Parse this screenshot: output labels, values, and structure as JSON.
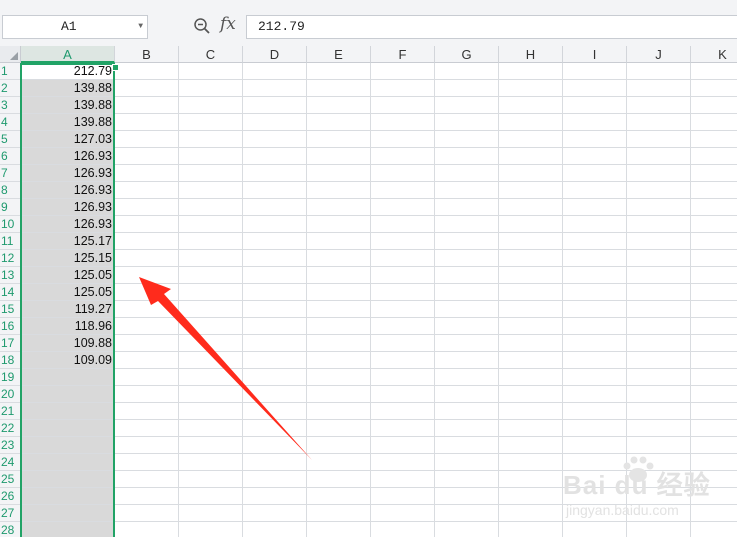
{
  "name_box": {
    "value": "A1"
  },
  "formula_bar": {
    "fx_label": "fx",
    "value": "212.79"
  },
  "columns": [
    "A",
    "B",
    "C",
    "D",
    "E",
    "F",
    "G",
    "H",
    "I",
    "J",
    "K"
  ],
  "selected_column": "A",
  "rows": [
    "1",
    "2",
    "3",
    "4",
    "5",
    "6",
    "7",
    "8",
    "9",
    "10",
    "11",
    "12",
    "13",
    "14",
    "15",
    "16",
    "17",
    "18",
    "19",
    "20",
    "21",
    "22",
    "23",
    "24",
    "25",
    "26",
    "27",
    "28"
  ],
  "cells_A": [
    "212.79",
    "139.88",
    "139.88",
    "139.88",
    "127.03",
    "126.93",
    "126.93",
    "126.93",
    "126.93",
    "126.93",
    "125.17",
    "125.15",
    "125.05",
    "125.05",
    "119.27",
    "118.96",
    "109.88",
    "109.09"
  ],
  "watermark": {
    "logo": "Bai du 经验",
    "sub": "jingyan.baidu.com"
  },
  "colors": {
    "accent": "#21a366",
    "arrow": "#ff2b1c",
    "selection_fill": "#d9d9d9"
  }
}
